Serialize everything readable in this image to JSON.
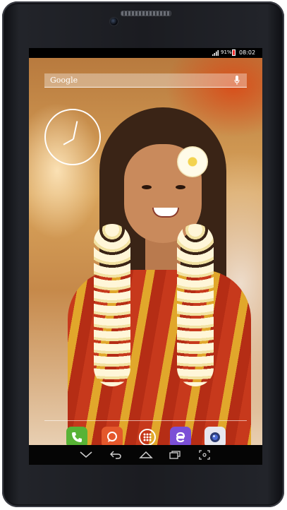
{
  "status_bar": {
    "battery": "91%",
    "time": "08:02"
  },
  "search_widget": {
    "label": "Google"
  },
  "clock_widget": {
    "hour": 8,
    "minute": 2
  },
  "dock": {
    "apps": [
      "phone",
      "messaging",
      "app-drawer",
      "browser",
      "camera"
    ]
  },
  "navigation": {
    "buttons": [
      "hide-keyboard",
      "back",
      "home",
      "recent-apps",
      "screenshot"
    ]
  },
  "colors": {
    "phone": "#58b336",
    "messaging": "#e4582c",
    "browser": "#7b4fd6",
    "camera": "#e7e7ef"
  }
}
